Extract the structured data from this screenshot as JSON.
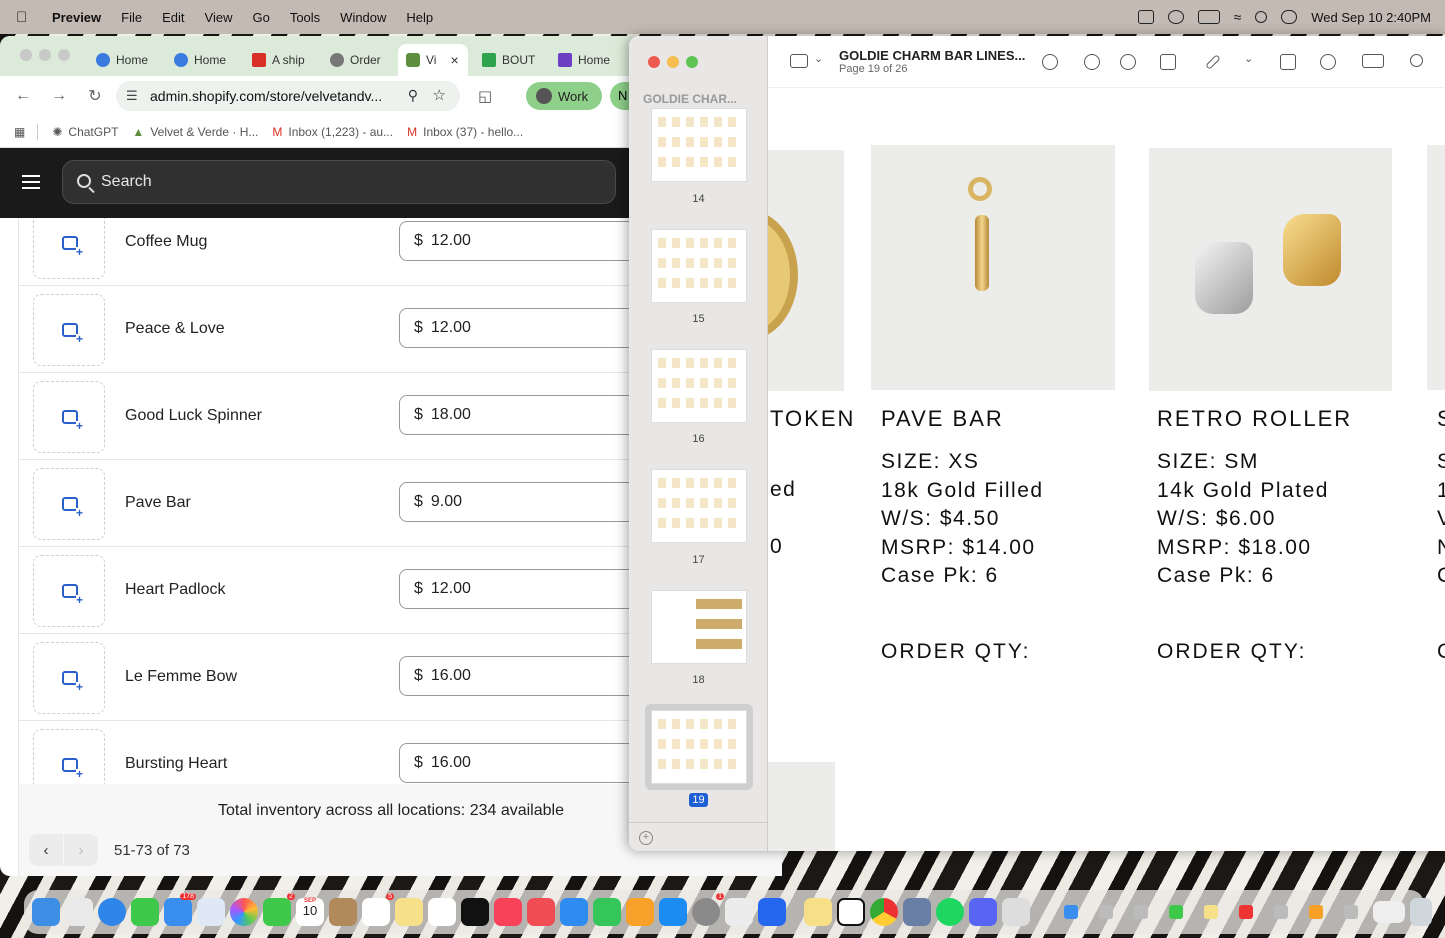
{
  "menubar": {
    "app": "Preview",
    "items": [
      "File",
      "Edit",
      "View",
      "Go",
      "Tools",
      "Window",
      "Help"
    ],
    "clock": "Wed Sep 10  2:40PM"
  },
  "chrome": {
    "tabs": [
      "Home",
      "Home",
      "A ship",
      "Order",
      "Vi",
      "BOUT",
      "Home"
    ],
    "url": "admin.shopify.com/store/velvetandv...",
    "profile": "Work",
    "profile_extra": "N",
    "bookmarks": [
      "ChatGPT",
      "Velvet & Verde · H...",
      "Inbox (1,223) - au...",
      "Inbox (37) - hello..."
    ]
  },
  "shopify": {
    "search_placeholder": "Search",
    "currency": "$",
    "products": [
      {
        "name": "Coffee Mug",
        "price": "12.00"
      },
      {
        "name": "Peace & Love",
        "price": "12.00"
      },
      {
        "name": "Good Luck Spinner",
        "price": "18.00"
      },
      {
        "name": "Pave Bar",
        "price": "9.00"
      },
      {
        "name": "Heart Padlock",
        "price": "12.00"
      },
      {
        "name": "Le Femme Bow",
        "price": "16.00"
      },
      {
        "name": "Bursting Heart",
        "price": "16.00"
      }
    ],
    "inventory_total": "Total inventory across all locations: 234 available",
    "pagination": "51-73 of 73"
  },
  "preview": {
    "title": "GOLDIE CHARM BAR LINES...",
    "subtitle": "Page 19 of 26",
    "sidebar_title": "GOLDIE CHAR...",
    "pages": [
      "14",
      "15",
      "16",
      "17",
      "18",
      "19"
    ],
    "current_page": "19",
    "products": [
      {
        "partial_title": "TOKEN",
        "partial_lines": [
          "ed",
          "0"
        ]
      },
      {
        "title": "PAVE BAR",
        "lines": [
          "SIZE: XS",
          "18k Gold Filled",
          "W/S: $4.50",
          "MSRP: $14.00",
          "Case Pk: 6"
        ],
        "order": "ORDER QTY:"
      },
      {
        "title": "RETRO ROLLER",
        "lines": [
          "SIZE: SM",
          "14k Gold Plated",
          "W/S: $6.00",
          "MSRP: $18.00",
          "Case Pk: 6"
        ],
        "order": "ORDER QTY:"
      }
    ],
    "edge_letters": [
      "S",
      "S",
      "1",
      "V",
      "N",
      "C",
      "C"
    ]
  },
  "dock": {
    "badges": [
      "178",
      "2",
      "5",
      "1"
    ],
    "calendar_month": "SEP",
    "calendar_day": "10"
  }
}
